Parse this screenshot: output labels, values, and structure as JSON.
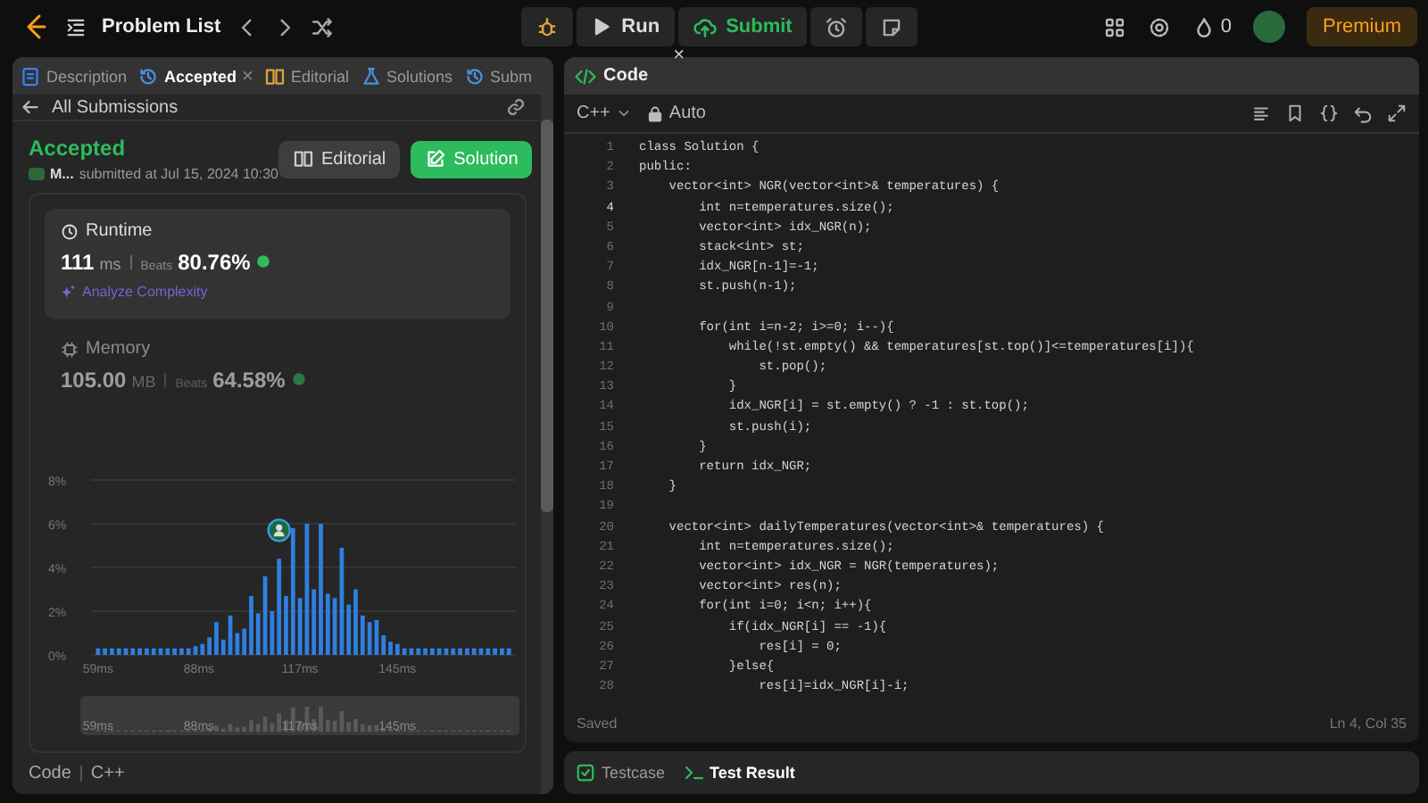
{
  "topbar": {
    "title": "Problem List",
    "run": "Run",
    "submit": "Submit",
    "tooltip_close": "×",
    "coins": "0",
    "premium": "Premium"
  },
  "left_tabs": [
    {
      "label": "Description",
      "selected": false,
      "kind": "description"
    },
    {
      "label": "Accepted",
      "selected": true,
      "kind": "submission",
      "close": "×"
    },
    {
      "label": "Editorial",
      "selected": false,
      "kind": "editorial"
    },
    {
      "label": "Solutions",
      "selected": false,
      "kind": "solutions"
    },
    {
      "label": "Subm",
      "selected": false,
      "kind": "submission"
    }
  ],
  "submission": {
    "back": "All Submissions",
    "status": "Accepted",
    "user": "M...",
    "submitted": "submitted at Jul 15, 2024 10:30",
    "editorial_button": "Editorial",
    "solution_button": "Solution"
  },
  "metrics": [
    {
      "kind": "runtime",
      "title": "Runtime",
      "value": "111",
      "unit": "ms",
      "beats_label": "Beats",
      "beats": "80.76%",
      "selected": true,
      "link": "Analyze Complexity"
    },
    {
      "kind": "memory",
      "title": "Memory",
      "value": "105.00",
      "unit": "MB",
      "beats_label": "Beats",
      "beats": "64.58%",
      "selected": false
    }
  ],
  "chart_data": {
    "type": "bar",
    "x": [
      59,
      61,
      63,
      65,
      67,
      69,
      71,
      73,
      75,
      77,
      79,
      81,
      83,
      85,
      87,
      89,
      91,
      93,
      95,
      97,
      99,
      101,
      103,
      105,
      107,
      109,
      111,
      113,
      115,
      117,
      119,
      121,
      123,
      125,
      127,
      129,
      131,
      133,
      135,
      137,
      139,
      141,
      143,
      145,
      147,
      149,
      151,
      153,
      155,
      157,
      159,
      161,
      163,
      165,
      167,
      169,
      171,
      173,
      175,
      177
    ],
    "values": [
      0.3,
      0.3,
      0.3,
      0.3,
      0.3,
      0.3,
      0.3,
      0.3,
      0.3,
      0.3,
      0.3,
      0.3,
      0.3,
      0.3,
      0.4,
      0.5,
      0.8,
      1.5,
      0.7,
      1.8,
      1.0,
      1.2,
      2.7,
      1.9,
      3.6,
      2.0,
      4.4,
      2.7,
      5.8,
      2.6,
      6.0,
      3.0,
      6.0,
      2.8,
      2.6,
      4.9,
      2.3,
      3.0,
      1.8,
      1.5,
      1.6,
      0.9,
      0.6,
      0.5,
      0.3,
      0.3,
      0.3,
      0.3,
      0.3,
      0.3,
      0.3,
      0.3,
      0.3,
      0.3,
      0.3,
      0.3,
      0.3,
      0.3,
      0.3,
      0.3
    ],
    "xlim": [
      57,
      179
    ],
    "ylim": [
      0,
      8
    ],
    "xticks": [
      {
        "value": 59,
        "label": "59ms"
      },
      {
        "value": 88,
        "label": "88ms"
      },
      {
        "value": 117,
        "label": "117ms"
      },
      {
        "value": 145,
        "label": "145ms"
      }
    ],
    "yticks": [
      {
        "value": 0,
        "label": "0%"
      },
      {
        "value": 2,
        "label": "2%"
      },
      {
        "value": 4,
        "label": "4%"
      },
      {
        "value": 6,
        "label": "6%"
      },
      {
        "value": 8,
        "label": "8%"
      }
    ],
    "grid": true
  },
  "brush_labels": [
    "59ms",
    "88ms",
    "117ms",
    "145ms"
  ],
  "code_footer": {
    "label": "Code",
    "language": "C++"
  },
  "editor": {
    "title": "Code",
    "language": "C++",
    "mode": "Auto",
    "status": "Saved",
    "cursor": "Ln 4, Col 35",
    "lines": [
      {
        "n": "1",
        "text": "class Solution {",
        "current": false
      },
      {
        "n": "2",
        "text": "public:",
        "current": false
      },
      {
        "n": "3",
        "text": "    vector<int> NGR(vector<int>& temperatures) {",
        "current": false
      },
      {
        "n": "4",
        "text": "        int n=temperatures.size();",
        "current": true
      },
      {
        "n": "5",
        "text": "        vector<int> idx_NGR(n);",
        "current": false
      },
      {
        "n": "6",
        "text": "        stack<int> st;",
        "current": false
      },
      {
        "n": "7",
        "text": "        idx_NGR[n-1]=-1;",
        "current": false
      },
      {
        "n": "8",
        "text": "        st.push(n-1);",
        "current": false
      },
      {
        "n": "9",
        "current": false
      },
      {
        "n": "10",
        "text": "        for(int i=n-2; i>=0; i--){",
        "current": false
      },
      {
        "n": "11",
        "text": "            while(!st.empty() && temperatures[st.top()]<=temperatures[i]){",
        "current": false
      },
      {
        "n": "12",
        "text": "                st.pop();",
        "current": false
      },
      {
        "n": "13",
        "text": "            }",
        "current": false
      },
      {
        "n": "14",
        "text": "            idx_NGR[i] = st.empty() ? -1 : st.top();",
        "current": false
      },
      {
        "n": "15",
        "text": "            st.push(i);",
        "current": false
      },
      {
        "n": "16",
        "text": "        }",
        "current": false
      },
      {
        "n": "17",
        "text": "        return idx_NGR;",
        "current": false
      },
      {
        "n": "18",
        "text": "    }",
        "current": false
      },
      {
        "n": "19",
        "current": false
      },
      {
        "n": "20",
        "text": "    vector<int> dailyTemperatures(vector<int>& temperatures) {",
        "current": false
      },
      {
        "n": "21",
        "text": "        int n=temperatures.size();",
        "current": false
      },
      {
        "n": "22",
        "text": "        vector<int> idx_NGR = NGR(temperatures);",
        "current": false
      },
      {
        "n": "23",
        "text": "        vector<int> res(n);",
        "current": false
      },
      {
        "n": "24",
        "text": "        for(int i=0; i<n; i++){",
        "current": false
      },
      {
        "n": "25",
        "text": "            if(idx_NGR[i] == -1){",
        "current": false
      },
      {
        "n": "26",
        "text": "                res[i] = 0;",
        "current": false
      },
      {
        "n": "27",
        "text": "            }else{",
        "current": false
      },
      {
        "n": "28",
        "text": "                res[i]=idx_NGR[i]-i;",
        "current": false
      }
    ]
  },
  "bottom_tabs": [
    {
      "label": "Testcase",
      "selected": false,
      "kind": "testcase"
    },
    {
      "label": "Test Result",
      "selected": true,
      "kind": "result"
    }
  ]
}
